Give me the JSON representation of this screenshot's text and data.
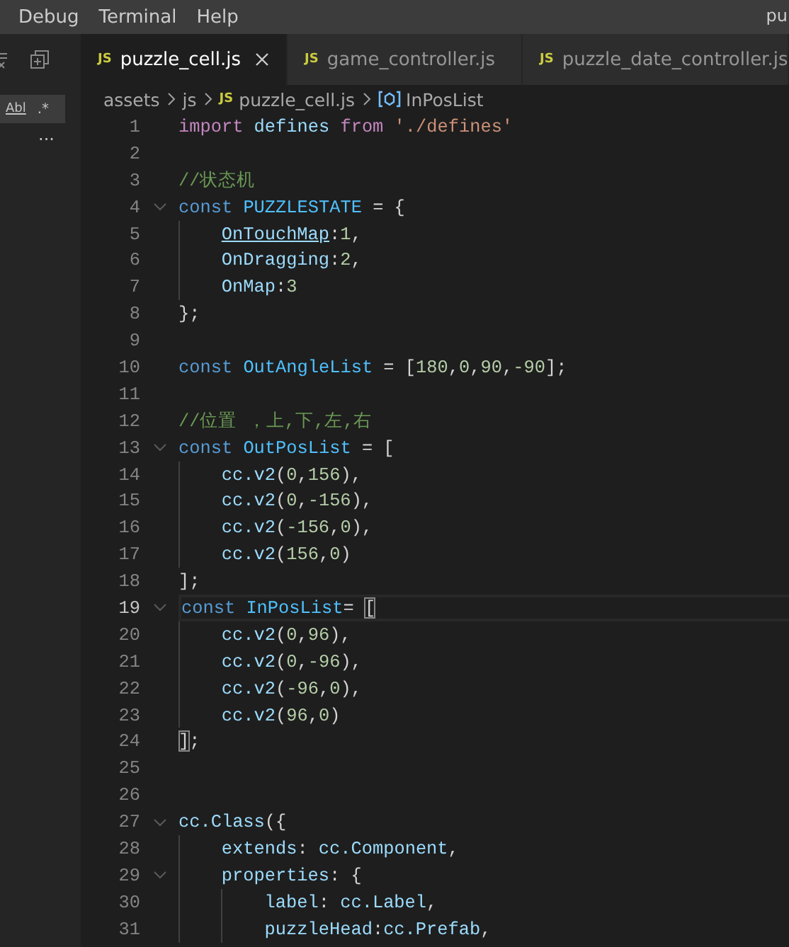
{
  "menu": [
    "Debug",
    "Terminal",
    "Help"
  ],
  "window": {
    "title": "pu"
  },
  "sidebar": {
    "search_options": [
      "Abl",
      ".*"
    ],
    "more": "..."
  },
  "tabs": [
    {
      "badge": "JS",
      "label": "puzzle_cell.js",
      "selected": true
    },
    {
      "badge": "JS",
      "label": "game_controller.js",
      "selected": false
    },
    {
      "badge": "JS",
      "label": "puzzle_date_controller.js",
      "selected": false
    }
  ],
  "breadcrumb": [
    {
      "kind": "folder",
      "label": "assets"
    },
    {
      "kind": "folder",
      "label": "js"
    },
    {
      "kind": "file",
      "badge": "JS",
      "label": "puzzle_cell.js"
    },
    {
      "kind": "symbol",
      "label": "InPosList"
    }
  ],
  "lines": [
    {
      "number": "1",
      "current": false,
      "tokens": [
        {
          "text": "import",
          "kind": "control"
        },
        {
          "text": " defines ",
          "kind": "var"
        },
        {
          "text": "from ",
          "kind": "control"
        },
        {
          "text": "'./defines'",
          "kind": "string"
        }
      ]
    },
    {
      "number": "2",
      "current": false
    },
    {
      "number": "3",
      "current": false,
      "tokens": [
        {
          "text": "//状态机",
          "kind": "comment"
        }
      ]
    },
    {
      "number": "4",
      "current": false,
      "tokens": [
        {
          "text": "const",
          "kind": "keyword"
        },
        {
          "text": " PUZZLESTATE",
          "kind": "const"
        },
        {
          "text": " = {",
          "kind": "punct"
        }
      ],
      "children": [
        {
          "number": "5",
          "current": false,
          "tokens": [
            {
              "text": "OnTouchMap",
              "kind": "link"
            },
            {
              "text": ":",
              "kind": "punct"
            },
            {
              "text": "1",
              "kind": "number"
            },
            {
              "text": ",",
              "kind": "punct"
            }
          ]
        },
        {
          "number": "6",
          "current": false,
          "tokens": [
            {
              "text": "OnDragging",
              "kind": "var"
            },
            {
              "text": ":",
              "kind": "punct"
            },
            {
              "text": "2",
              "kind": "number"
            },
            {
              "text": ",",
              "kind": "punct"
            }
          ]
        },
        {
          "number": "7",
          "current": false,
          "tokens": [
            {
              "text": "OnMap",
              "kind": "var"
            },
            {
              "text": ":",
              "kind": "punct"
            },
            {
              "text": "3",
              "kind": "number"
            }
          ]
        }
      ]
    },
    {
      "number": "8",
      "current": false,
      "tokens": [
        {
          "text": "};",
          "kind": "punct"
        }
      ]
    },
    {
      "number": "9",
      "current": false
    },
    {
      "number": "10",
      "current": false,
      "tokens": [
        {
          "text": "const",
          "kind": "keyword"
        },
        {
          "text": " OutAngleList",
          "kind": "const"
        },
        {
          "text": " = [",
          "kind": "punct"
        },
        {
          "text": "180",
          "kind": "number"
        },
        {
          "text": ",",
          "kind": "punct"
        },
        {
          "text": "0",
          "kind": "number"
        },
        {
          "text": ",",
          "kind": "punct"
        },
        {
          "text": "90",
          "kind": "number"
        },
        {
          "text": ",",
          "kind": "punct"
        },
        {
          "text": "-90",
          "kind": "number"
        },
        {
          "text": "];",
          "kind": "punct"
        }
      ]
    },
    {
      "number": "11",
      "current": false
    },
    {
      "number": "12",
      "current": false,
      "tokens": [
        {
          "text": "//位置 ，上,下,左,右",
          "kind": "comment"
        }
      ]
    },
    {
      "number": "13",
      "current": false,
      "tokens": [
        {
          "text": "const",
          "kind": "keyword"
        },
        {
          "text": " OutPosList",
          "kind": "const"
        },
        {
          "text": " = [",
          "kind": "punct"
        }
      ],
      "children": [
        {
          "number": "14",
          "current": false,
          "tokens": [
            {
              "text": "cc.v2",
              "kind": "var"
            },
            {
              "text": "(",
              "kind": "punct"
            },
            {
              "text": "0",
              "kind": "number"
            },
            {
              "text": ",",
              "kind": "punct"
            },
            {
              "text": "156",
              "kind": "number"
            },
            {
              "text": "),",
              "kind": "punct"
            }
          ]
        },
        {
          "number": "15",
          "current": false,
          "tokens": [
            {
              "text": "cc.v2",
              "kind": "var"
            },
            {
              "text": "(",
              "kind": "punct"
            },
            {
              "text": "0",
              "kind": "number"
            },
            {
              "text": ",",
              "kind": "punct"
            },
            {
              "text": "-156",
              "kind": "number"
            },
            {
              "text": "),",
              "kind": "punct"
            }
          ]
        },
        {
          "number": "16",
          "current": false,
          "tokens": [
            {
              "text": "cc.v2",
              "kind": "var"
            },
            {
              "text": "(",
              "kind": "punct"
            },
            {
              "text": "-156",
              "kind": "number"
            },
            {
              "text": ",",
              "kind": "punct"
            },
            {
              "text": "0",
              "kind": "number"
            },
            {
              "text": "),",
              "kind": "punct"
            }
          ]
        },
        {
          "number": "17",
          "current": false,
          "tokens": [
            {
              "text": "cc.v2",
              "kind": "var"
            },
            {
              "text": "(",
              "kind": "punct"
            },
            {
              "text": "156",
              "kind": "number"
            },
            {
              "text": ",",
              "kind": "punct"
            },
            {
              "text": "0",
              "kind": "number"
            },
            {
              "text": ")",
              "kind": "punct"
            }
          ]
        }
      ]
    },
    {
      "number": "18",
      "current": false,
      "tokens": [
        {
          "text": "];",
          "kind": "punct"
        }
      ]
    },
    {
      "number": "19",
      "current": true,
      "tokens": [
        {
          "text": "const",
          "kind": "keyword"
        },
        {
          "text": " InPosList",
          "kind": "const"
        },
        {
          "text": "= ",
          "kind": "punct"
        },
        {
          "text": "[",
          "kind": "bracket"
        }
      ],
      "children": [
        {
          "number": "20",
          "current": false,
          "tokens": [
            {
              "text": "cc.v2",
              "kind": "var"
            },
            {
              "text": "(",
              "kind": "punct"
            },
            {
              "text": "0",
              "kind": "number"
            },
            {
              "text": ",",
              "kind": "punct"
            },
            {
              "text": "96",
              "kind": "number"
            },
            {
              "text": "),",
              "kind": "punct"
            }
          ]
        },
        {
          "number": "21",
          "current": false,
          "tokens": [
            {
              "text": "cc.v2",
              "kind": "var"
            },
            {
              "text": "(",
              "kind": "punct"
            },
            {
              "text": "0",
              "kind": "number"
            },
            {
              "text": ",",
              "kind": "punct"
            },
            {
              "text": "-96",
              "kind": "number"
            },
            {
              "text": "),",
              "kind": "punct"
            }
          ]
        },
        {
          "number": "22",
          "current": false,
          "tokens": [
            {
              "text": "cc.v2",
              "kind": "var"
            },
            {
              "text": "(",
              "kind": "punct"
            },
            {
              "text": "-96",
              "kind": "number"
            },
            {
              "text": ",",
              "kind": "punct"
            },
            {
              "text": "0",
              "kind": "number"
            },
            {
              "text": "),",
              "kind": "punct"
            }
          ]
        },
        {
          "number": "23",
          "current": false,
          "tokens": [
            {
              "text": "cc.v2",
              "kind": "var"
            },
            {
              "text": "(",
              "kind": "punct"
            },
            {
              "text": "96",
              "kind": "number"
            },
            {
              "text": ",",
              "kind": "punct"
            },
            {
              "text": "0",
              "kind": "number"
            },
            {
              "text": ")",
              "kind": "punct"
            }
          ]
        }
      ]
    },
    {
      "number": "24",
      "current": false,
      "tokens": [
        {
          "text": "]",
          "kind": "bracket"
        },
        {
          "text": ";",
          "kind": "punct"
        }
      ]
    },
    {
      "number": "25",
      "current": false
    },
    {
      "number": "26",
      "current": false
    },
    {
      "number": "27",
      "current": false,
      "tokens": [
        {
          "text": "cc.Class",
          "kind": "var"
        },
        {
          "text": "({",
          "kind": "punct"
        }
      ],
      "children": [
        {
          "number": "28",
          "current": false,
          "tokens": [
            {
              "text": "extends",
              "kind": "var"
            },
            {
              "text": ": ",
              "kind": "punct"
            },
            {
              "text": "cc.Component",
              "kind": "var"
            },
            {
              "text": ",",
              "kind": "punct"
            }
          ]
        },
        {
          "number": "29",
          "current": false,
          "tokens": [
            {
              "text": "properties",
              "kind": "var"
            },
            {
              "text": ": {",
              "kind": "punct"
            }
          ],
          "children": [
            {
              "number": "30",
              "current": false,
              "tokens": [
                {
                  "text": "label",
                  "kind": "var"
                },
                {
                  "text": ": ",
                  "kind": "punct"
                },
                {
                  "text": "cc.Label",
                  "kind": "var"
                },
                {
                  "text": ",",
                  "kind": "punct"
                }
              ]
            },
            {
              "number": "31",
              "current": false,
              "tokens": [
                {
                  "text": "puzzleHead",
                  "kind": "var"
                },
                {
                  "text": ":",
                  "kind": "punct"
                },
                {
                  "text": "cc.Prefab",
                  "kind": "var"
                },
                {
                  "text": ",",
                  "kind": "punct"
                }
              ]
            }
          ]
        }
      ]
    }
  ]
}
